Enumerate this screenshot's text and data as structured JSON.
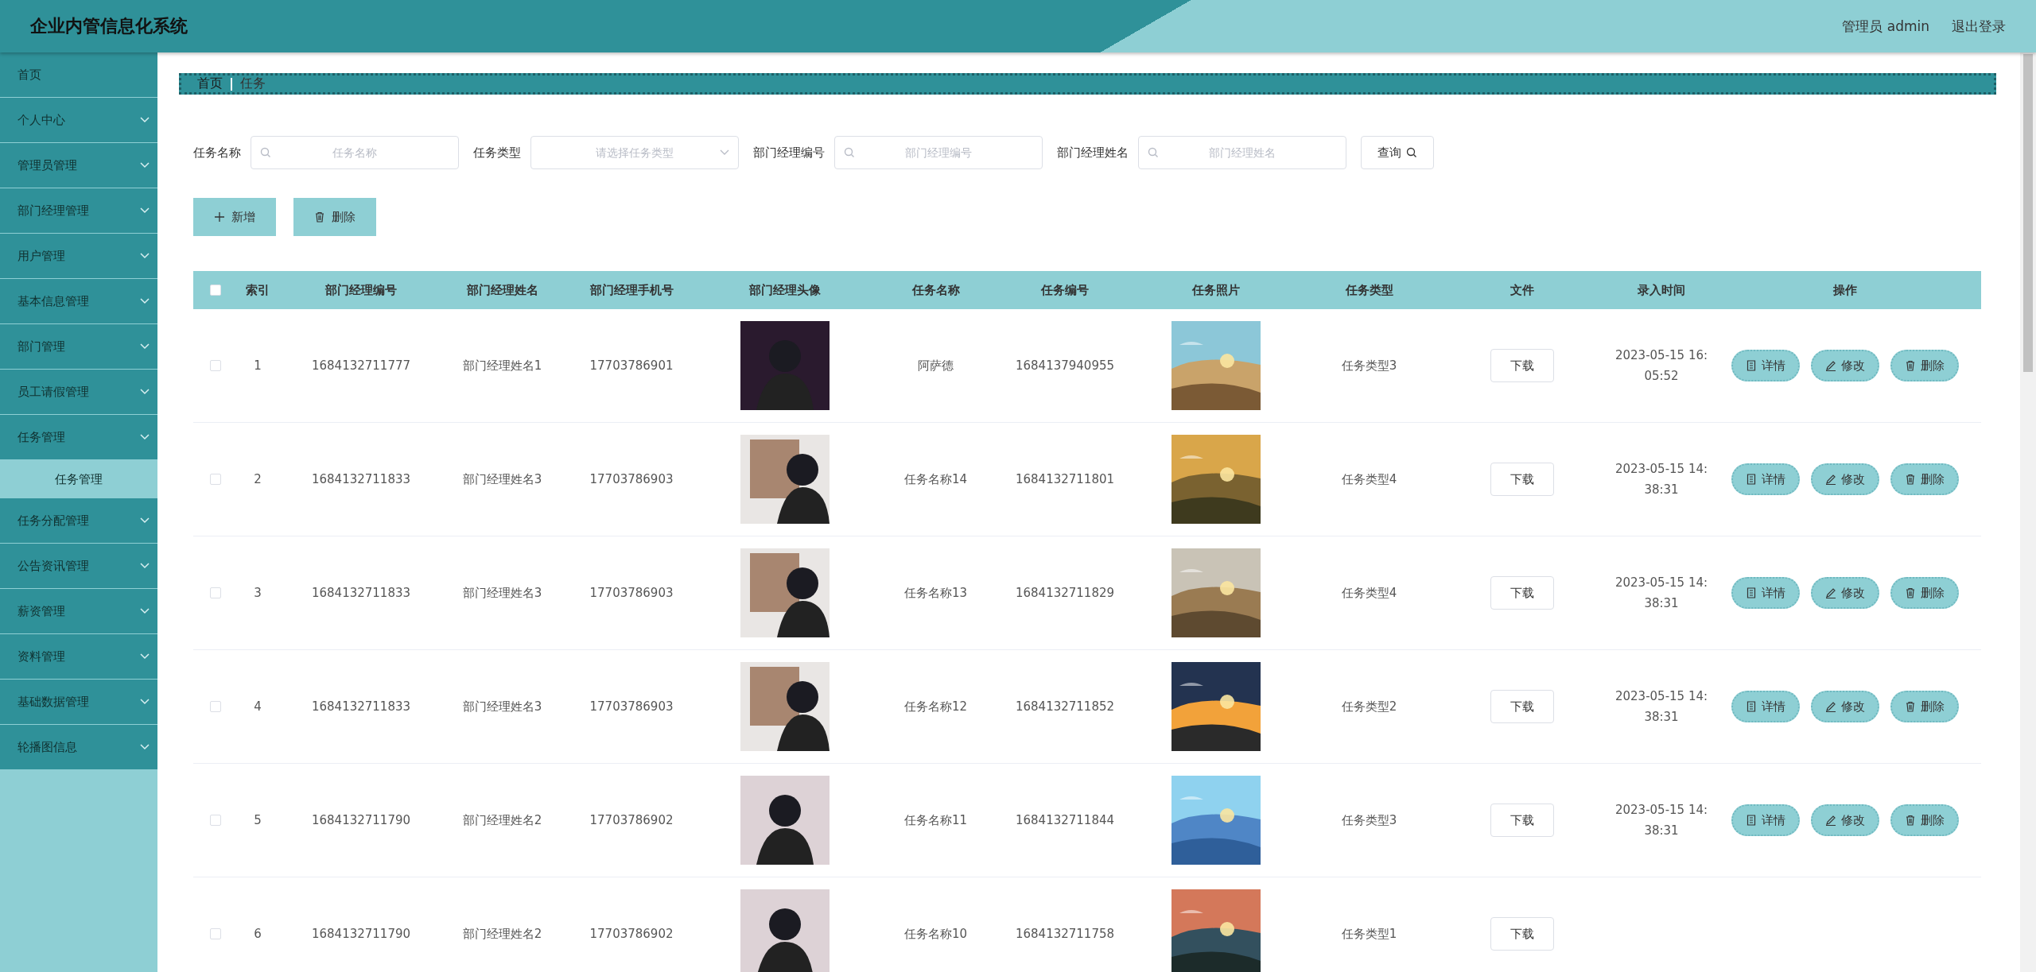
{
  "header": {
    "title": "企业内管信息化系统",
    "user": "管理员 admin",
    "logout": "退出登录"
  },
  "sidebar": {
    "items": [
      {
        "label": "首页",
        "expandable": false,
        "selected": false
      },
      {
        "label": "个人中心",
        "expandable": true,
        "selected": false
      },
      {
        "label": "管理员管理",
        "expandable": true,
        "selected": false
      },
      {
        "label": "部门经理管理",
        "expandable": true,
        "selected": false
      },
      {
        "label": "用户管理",
        "expandable": true,
        "selected": false
      },
      {
        "label": "基本信息管理",
        "expandable": true,
        "selected": false
      },
      {
        "label": "部门管理",
        "expandable": true,
        "selected": false
      },
      {
        "label": "员工请假管理",
        "expandable": true,
        "selected": false
      },
      {
        "label": "任务管理",
        "expandable": true,
        "selected": false,
        "children": [
          {
            "label": "任务管理",
            "selected": true
          }
        ]
      },
      {
        "label": "任务分配管理",
        "expandable": true,
        "selected": false
      },
      {
        "label": "公告资讯管理",
        "expandable": true,
        "selected": false
      },
      {
        "label": "薪资管理",
        "expandable": true,
        "selected": false
      },
      {
        "label": "资料管理",
        "expandable": true,
        "selected": false
      },
      {
        "label": "基础数据管理",
        "expandable": true,
        "selected": false
      },
      {
        "label": "轮播图信息",
        "expandable": true,
        "selected": false
      }
    ]
  },
  "breadcrumb": [
    "首页",
    "任务"
  ],
  "search": {
    "fields": [
      {
        "label": "任务名称",
        "kind": "text",
        "placeholder": "任务名称"
      },
      {
        "label": "任务类型",
        "kind": "select",
        "placeholder": "请选择任务类型"
      },
      {
        "label": "部门经理编号",
        "kind": "text",
        "placeholder": "部门经理编号"
      },
      {
        "label": "部门经理姓名",
        "kind": "text",
        "placeholder": "部门经理姓名"
      }
    ],
    "button": "查询"
  },
  "actions": [
    {
      "label": "新增",
      "kind": "add"
    },
    {
      "label": "删除",
      "kind": "delete"
    }
  ],
  "table": {
    "select_all": {
      "checked": false
    },
    "columns": [
      "索引",
      "部门经理编号",
      "部门经理姓名",
      "部门经理手机号",
      "部门经理头像",
      "任务名称",
      "任务编号",
      "任务照片",
      "任务类型",
      "文件",
      "录入时间",
      "操作"
    ],
    "rows": [
      {
        "checked": false,
        "index": "1",
        "manager_no": "1684132711777",
        "manager_name": "部门经理姓名1",
        "phone": "17703786901",
        "task_name": "阿萨德",
        "task_no": "1684137940955",
        "task_type": "任务类型3",
        "file": "下载",
        "time": "2023-05-15 16:05:52",
        "operations": [
          "详情",
          "修改",
          "删除"
        ]
      },
      {
        "checked": false,
        "index": "2",
        "manager_no": "1684132711833",
        "manager_name": "部门经理姓名3",
        "phone": "17703786903",
        "task_name": "任务名称14",
        "task_no": "1684132711801",
        "task_type": "任务类型4",
        "file": "下载",
        "time": "2023-05-15 14:38:31",
        "operations": [
          "详情",
          "修改",
          "删除"
        ]
      },
      {
        "checked": false,
        "index": "3",
        "manager_no": "1684132711833",
        "manager_name": "部门经理姓名3",
        "phone": "17703786903",
        "task_name": "任务名称13",
        "task_no": "1684132711829",
        "task_type": "任务类型4",
        "file": "下载",
        "time": "2023-05-15 14:38:31",
        "operations": [
          "详情",
          "修改",
          "删除"
        ]
      },
      {
        "checked": false,
        "index": "4",
        "manager_no": "1684132711833",
        "manager_name": "部门经理姓名3",
        "phone": "17703786903",
        "task_name": "任务名称12",
        "task_no": "1684132711852",
        "task_type": "任务类型2",
        "file": "下载",
        "time": "2023-05-15 14:38:31",
        "operations": [
          "详情",
          "修改",
          "删除"
        ]
      },
      {
        "checked": false,
        "index": "5",
        "manager_no": "1684132711790",
        "manager_name": "部门经理姓名2",
        "phone": "17703786902",
        "task_name": "任务名称11",
        "task_no": "1684132711844",
        "task_type": "任务类型3",
        "file": "下载",
        "time": "2023-05-15 14:38:31",
        "operations": [
          "详情",
          "修改",
          "删除"
        ]
      },
      {
        "checked": false,
        "index": "6",
        "manager_no": "1684132711790",
        "manager_name": "部门经理姓名2",
        "phone": "17703786902",
        "task_name": "任务名称10",
        "task_no": "1684132711758",
        "task_type": "任务类型1",
        "file": "下载"
      }
    ]
  }
}
